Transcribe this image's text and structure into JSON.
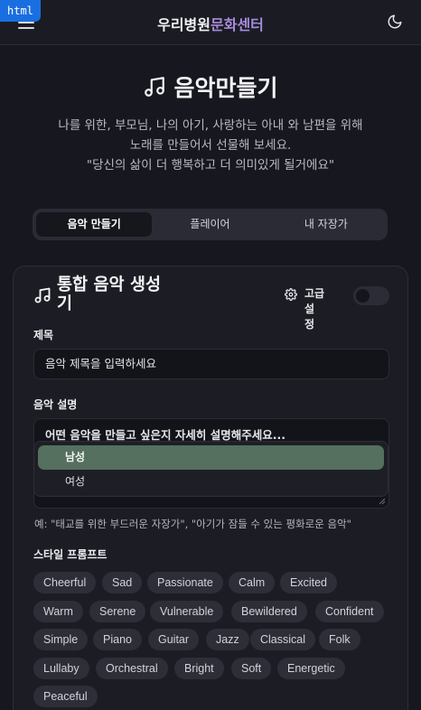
{
  "badge": "html",
  "header": {
    "brand_part1": "우리병원",
    "brand_part2": "문화센터"
  },
  "hero": {
    "title": "음악만들기",
    "desc_line1": "나를 위한, 부모님, 나의 아기, 사랑하는 아내 와 남편을 위해",
    "desc_line2": "노래를 만들어서 선물해 보세요.",
    "desc_line3": "\"당신의 삶이 더 행복하고 더 의미있게 될거에요\""
  },
  "tabs": [
    {
      "label": "음악 만들기",
      "active": true
    },
    {
      "label": "플레이어",
      "active": false
    },
    {
      "label": "내 자장가",
      "active": false
    }
  ],
  "card": {
    "title_line1": "통합 음악 생성",
    "title_line2": "기",
    "advanced_label_line1": "고급 설",
    "advanced_label_line2": "정",
    "advanced_enabled": false,
    "title_field": {
      "label": "제목",
      "placeholder": "음악 제목을 입력하세요"
    },
    "desc_field": {
      "label": "음악 설명",
      "placeholder": "어떤 음악을 만들고 싶은지 자세히 설명해주세요...",
      "hint": "예: \"태교를 위한 부드러운 자장가\", \"아기가 잠들 수 있는 평화로운 음악\""
    },
    "dropdown_options": [
      {
        "label": "남성",
        "selected": true
      },
      {
        "label": "여성",
        "selected": false
      }
    ],
    "style_label": "스타일 프롬프트",
    "style_chips": [
      "Cheerful",
      "Sad",
      "Passionate",
      "Calm",
      "Excited",
      "Warm",
      "Serene",
      "Vulnerable",
      "Bewildered",
      "Confident",
      "Simple",
      "Piano",
      "Guitar",
      "Jazz",
      "Classical",
      "Folk",
      "Lullaby",
      "Orchestral",
      "Bright",
      "Soft",
      "Energetic",
      "Peaceful"
    ]
  },
  "colors": {
    "accent_purple": "#a78bdc",
    "selected_option": "#55705e",
    "background": "#17181f"
  }
}
